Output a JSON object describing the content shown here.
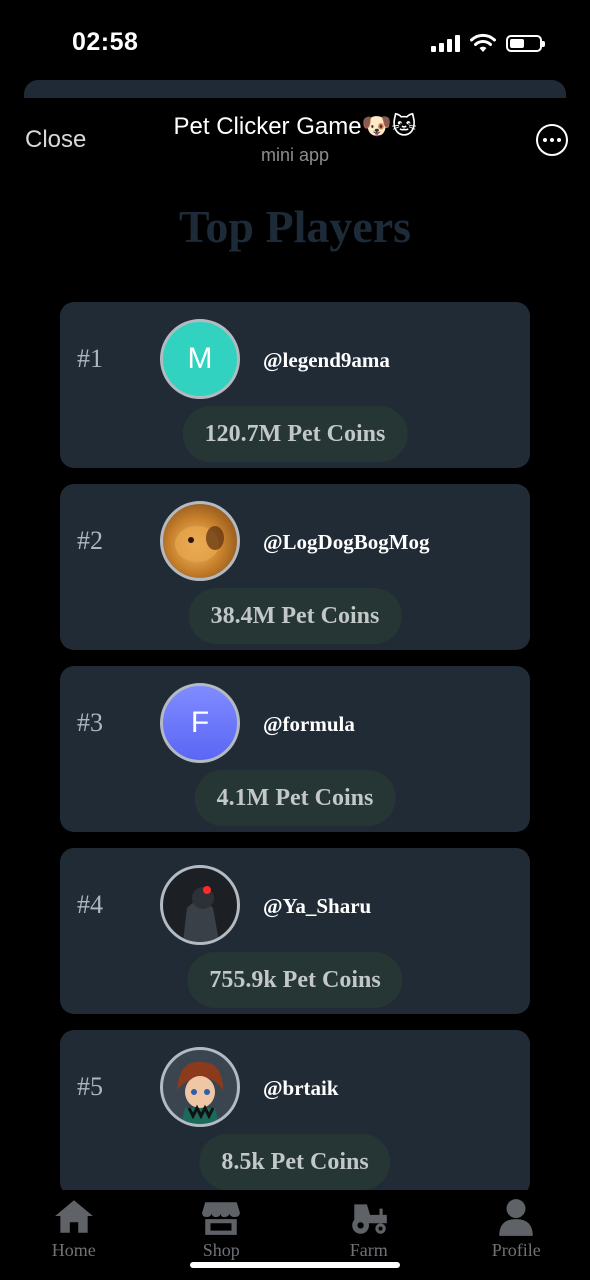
{
  "status_bar": {
    "time": "02:58"
  },
  "header": {
    "close_label": "Close",
    "title": "Pet Clicker Game🐶🐱",
    "subtitle": "mini app"
  },
  "page_heading": "Top Players",
  "players": [
    {
      "rank": "#1",
      "username": "@legend9ama",
      "coins": "120.7M Pet Coins",
      "avatar_letter": "M",
      "avatar_color": "#31d3c0"
    },
    {
      "rank": "#2",
      "username": "@LogDogBogMog",
      "coins": "38.4M Pet Coins",
      "avatar_letter": "",
      "avatar_color": "#c9822c"
    },
    {
      "rank": "#3",
      "username": "@formula",
      "coins": "4.1M Pet Coins",
      "avatar_letter": "F",
      "avatar_color": "#6d7aff"
    },
    {
      "rank": "#4",
      "username": "@Ya_Sharu",
      "coins": "755.9k Pet Coins",
      "avatar_letter": "",
      "avatar_color": "#25292e"
    },
    {
      "rank": "#5",
      "username": "@brtaik",
      "coins": "8.5k Pet Coins",
      "avatar_letter": "",
      "avatar_color": "#3b4550"
    }
  ],
  "nav": [
    {
      "label": "Home",
      "icon": "home-icon"
    },
    {
      "label": "Shop",
      "icon": "shop-icon"
    },
    {
      "label": "Farm",
      "icon": "tractor-icon"
    },
    {
      "label": "Profile",
      "icon": "profile-icon"
    }
  ],
  "colors": {
    "background": "#000000",
    "card": "#212b36",
    "coin_pill": "#253634",
    "heading": "#1d2a37",
    "nav_icon": "#5f6368"
  }
}
